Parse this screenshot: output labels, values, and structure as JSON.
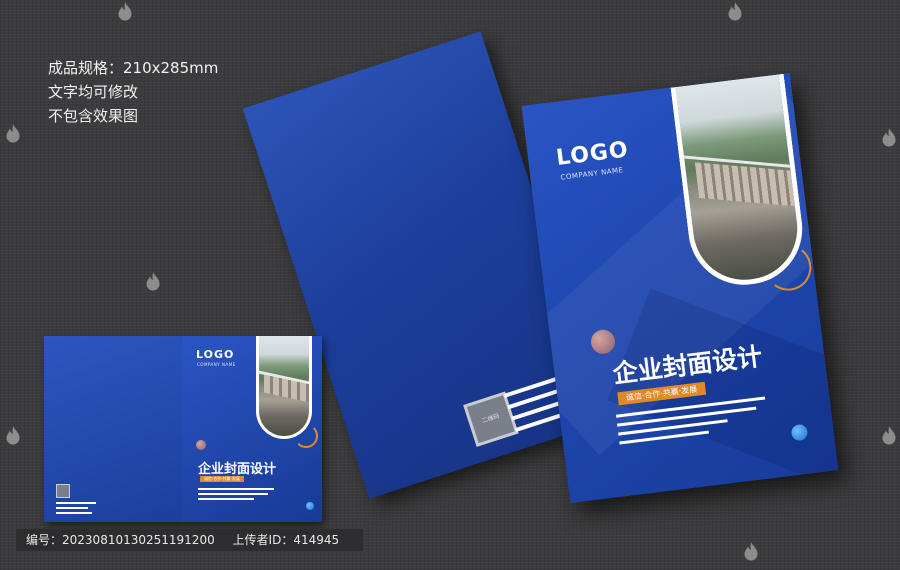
{
  "spec": {
    "line1": "成品规格：210x285mm",
    "line2": "文字均可修改",
    "line3": "不包含效果图"
  },
  "cover": {
    "logo": "LOGO",
    "company": "COMPANY NAME",
    "title": "企业封面设计",
    "slogan": "诚信·合作·共赢·发展",
    "qr_label": "二维码"
  },
  "colors": {
    "cover_blue": "#1f48b2",
    "accent_orange": "#e0892b",
    "background": "#3b3b3d"
  },
  "footer": {
    "id_label": "编号：",
    "id_value": "20230810130251191200",
    "uploader_label": "上传者ID：",
    "uploader_value": "414945"
  },
  "watermark": {
    "icon": "flame-watermark-icon"
  }
}
